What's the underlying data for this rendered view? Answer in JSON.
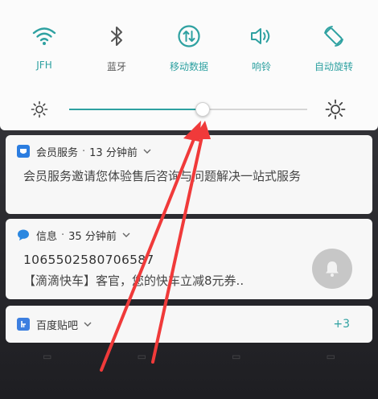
{
  "quick_settings": {
    "tiles": [
      {
        "label": "JFH",
        "icon": "wifi-icon",
        "active": true
      },
      {
        "label": "蓝牙",
        "icon": "bluetooth-icon",
        "active": false
      },
      {
        "label": "移动数据",
        "icon": "mobile-data-icon",
        "active": true
      },
      {
        "label": "响铃",
        "icon": "ring-volume-icon",
        "active": true
      },
      {
        "label": "自动旋转",
        "icon": "auto-rotate-icon",
        "active": true
      }
    ],
    "brightness": {
      "level_percent": 56
    }
  },
  "notifications": [
    {
      "app": "会员服务",
      "time": "13 分钟前",
      "body": "会员服务邀请您体验售后咨询与问题解决一站式服务"
    },
    {
      "app": "信息",
      "time": "35 分钟前",
      "sender": "1065502580706587",
      "body": "【滴滴快车】客官，您的快车立减8元券.."
    },
    {
      "app": "百度贴吧",
      "more_count": "+3"
    }
  ],
  "colors": {
    "accent": "#2ea1a1",
    "annotation_arrow": "#f03a3a",
    "panel_bg": "#fbfbfb",
    "card_bg": "#f7f7f7"
  }
}
